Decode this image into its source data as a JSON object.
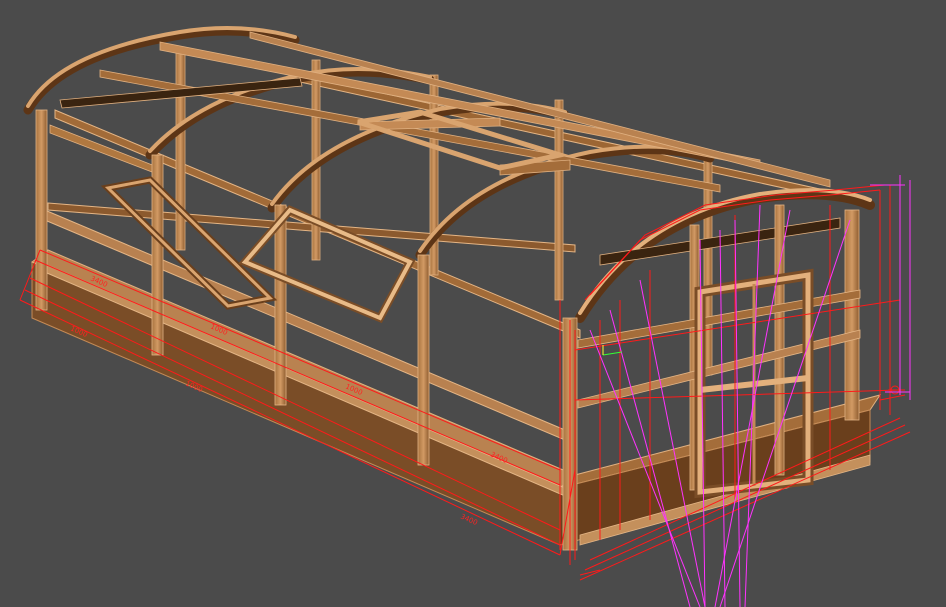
{
  "viewport": {
    "background_color": "#4b4b4b",
    "model": "greenhouse-frame",
    "colors": {
      "wood_light": "#c8915e",
      "wood_mid": "#a8733f",
      "wood_dark": "#6a3f1c",
      "wood_edge": "#e0b080",
      "dimension_line": "#ff1a1a",
      "guide_line": "#ff33ff"
    }
  },
  "dimensions": {
    "labels": [
      "3400",
      "1000",
      "1000",
      "1000",
      "1000",
      "3400",
      "3400"
    ]
  }
}
